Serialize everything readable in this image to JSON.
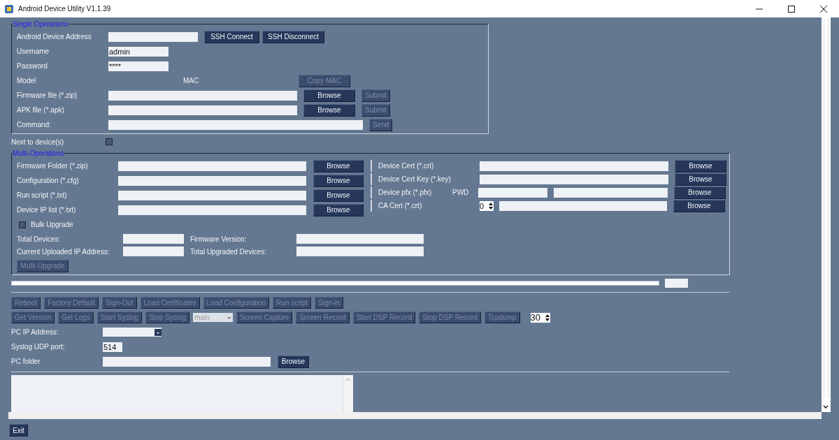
{
  "window": {
    "title": "Android Device Utility V1.1.39"
  },
  "single_operations": {
    "title": "Single Operations",
    "address": {
      "label": "Android Device Address"
    },
    "connect_buttons": [
      {
        "label": "SSH Connect",
        "disabled": false
      },
      {
        "label": "SSH Disconnect",
        "disabled": false
      }
    ],
    "username": {
      "label": "Username",
      "value": "admin"
    },
    "password": {
      "label": "Password",
      "value": "****"
    },
    "model": {
      "label": "Model",
      "mac_label": "MAC",
      "copy_button": {
        "label": "Copy MAC",
        "disabled": true
      }
    },
    "file_rows": [
      {
        "label": "Firmware file (*.zip)",
        "browse": {
          "label": "Browse",
          "disabled": false
        },
        "submit": {
          "label": "Submit",
          "disabled": true
        }
      },
      {
        "label": "APK file (*.apk)",
        "browse": {
          "label": "Browse",
          "disabled": false
        },
        "submit": {
          "label": "Submit",
          "disabled": true
        }
      }
    ],
    "command": {
      "label": "Command:",
      "send": {
        "label": "Send",
        "disabled": true
      }
    }
  },
  "next_to_device": {
    "label": "Next to device(s)",
    "checked": false
  },
  "multi_operations": {
    "title": "Multi-Operations",
    "left_rows": [
      {
        "label": "Firmware Folder (*.zip)",
        "button": {
          "label": "Browse",
          "disabled": false
        }
      },
      {
        "label": "Configuration (*.cfg)",
        "button": {
          "label": "Browse",
          "disabled": false
        }
      },
      {
        "label": "Run script (*.txt)",
        "button": {
          "label": "Browse",
          "disabled": false
        }
      },
      {
        "label": "Device IP list (*.txt)",
        "button": {
          "label": "Browse",
          "disabled": false
        }
      }
    ],
    "right_rows": [
      {
        "kind": "file",
        "label": "Device Cert (*.crt)",
        "button": {
          "label": "Browse",
          "disabled": false
        }
      },
      {
        "kind": "file",
        "label": "Device Cert Key (*.key)",
        "button": {
          "label": "Browse",
          "disabled": false
        }
      },
      {
        "kind": "pfx",
        "label": "Device pfx (*.pfx)",
        "pwd_label": "PWD",
        "button": {
          "label": "Browse",
          "disabled": false
        }
      },
      {
        "kind": "spin",
        "label": "CA Cert (*.crt)",
        "spin_value": "0",
        "button": {
          "label": "Browse",
          "disabled": false
        }
      }
    ],
    "bulk_upgrade": {
      "label": "Bulk Upgrade",
      "checked": false
    },
    "stats": [
      {
        "label": "Total Devices:"
      },
      {
        "label": "Firmware Version:"
      },
      {
        "label": "Current Uploaded IP Address:"
      },
      {
        "label": "Total Upgraded Devices:"
      }
    ],
    "upgrade_button": {
      "label": "Multi-Upgrade",
      "disabled": true
    }
  },
  "progress": {
    "level": 1
  },
  "action_row_1": [
    {
      "label": "Reboot",
      "disabled": true
    },
    {
      "label": "Factory Default",
      "disabled": true
    },
    {
      "label": "Sign-Out",
      "disabled": true
    },
    {
      "label": "Load Certificates",
      "disabled": true
    },
    {
      "label": "Load Configuration",
      "disabled": true
    },
    {
      "label": "Run script",
      "disabled": true
    },
    {
      "label": "Sign-in",
      "disabled": true
    }
  ],
  "action_row_2": [
    {
      "kind": "button",
      "label": "Get Version",
      "disabled": true
    },
    {
      "kind": "button",
      "label": "Get Logs",
      "disabled": true
    },
    {
      "kind": "button",
      "label": "Start Syslog",
      "disabled": true
    },
    {
      "kind": "button",
      "label": "Stop Syslog",
      "disabled": true
    },
    {
      "kind": "select",
      "label": "main",
      "disabled": true
    },
    {
      "kind": "button",
      "label": "Screen Capture",
      "disabled": true
    },
    {
      "kind": "button",
      "label": "Screen Record",
      "disabled": true
    },
    {
      "kind": "button",
      "label": "Start DSP Record",
      "disabled": true
    },
    {
      "kind": "button",
      "label": "Stop DSP Record",
      "disabled": true
    },
    {
      "kind": "button",
      "label": "Tcpdump",
      "disabled": true
    },
    {
      "kind": "spin",
      "label": "30"
    }
  ],
  "pc_settings": {
    "ip_label": "PC IP Address:",
    "port_label": "Syslog UDP port:",
    "port_value": "514",
    "folder_label": "PC folder",
    "browse": {
      "label": "Browse",
      "disabled": false
    }
  },
  "exit_button": {
    "label": "Exit",
    "disabled": false
  }
}
